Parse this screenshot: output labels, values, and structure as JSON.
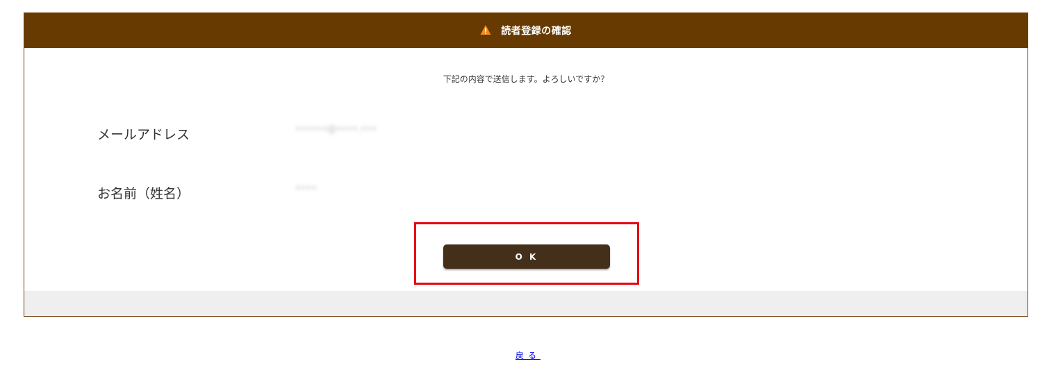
{
  "header": {
    "title": "読者登録の確認",
    "icon": "warning-icon",
    "background_color": "#663a00"
  },
  "intro_text": "下記の内容で送信します。よろしいですか？",
  "fields": [
    {
      "label": "メールアドレス",
      "value": "••••••@••••.•••"
    },
    {
      "label": "お名前（姓名）",
      "value": "••••"
    }
  ],
  "ok_button": {
    "label": "O K",
    "color": "#44301a"
  },
  "highlight_color": "#e60012",
  "back_link": {
    "label": "戻る"
  }
}
